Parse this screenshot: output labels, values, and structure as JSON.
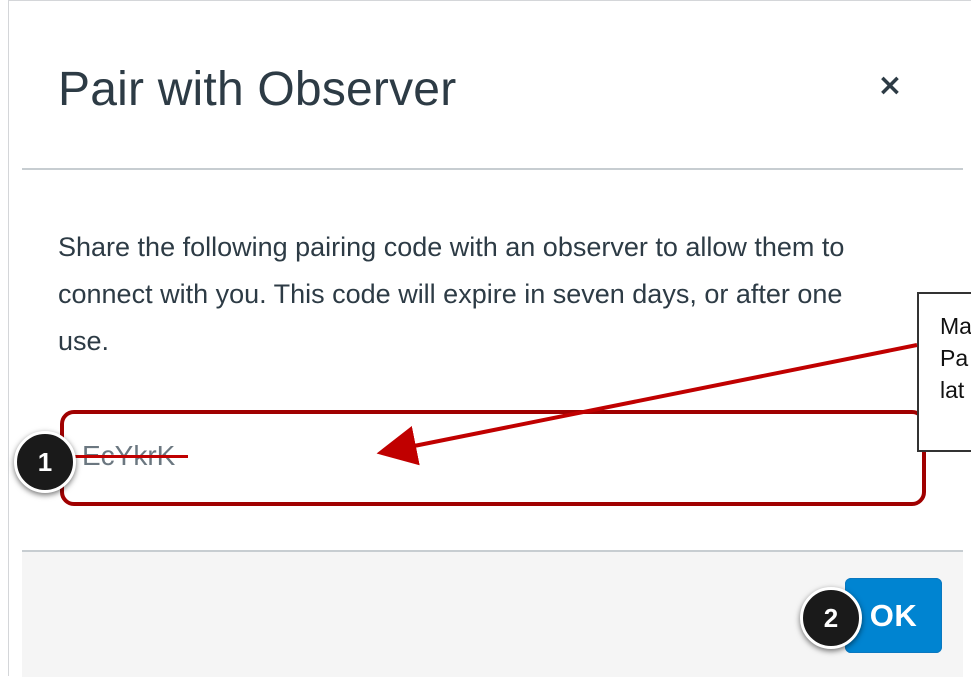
{
  "dialog": {
    "title": "Pair with Observer",
    "close_label": "×",
    "description": "Share the following pairing code with an observer to allow them to connect with you. This code will expire in seven days, or after one use.",
    "pairing_code": "EcYkrK",
    "ok_label": "OK"
  },
  "annotations": {
    "badge_1": "1",
    "badge_2": "2",
    "callout_text": "Ma\nPa\nlat"
  },
  "colors": {
    "primary_button": "#0084d1",
    "highlight_border": "#a00000",
    "arrow": "#c00000",
    "title_text": "#2d3b45"
  },
  "icons": {
    "close": "close-icon"
  }
}
